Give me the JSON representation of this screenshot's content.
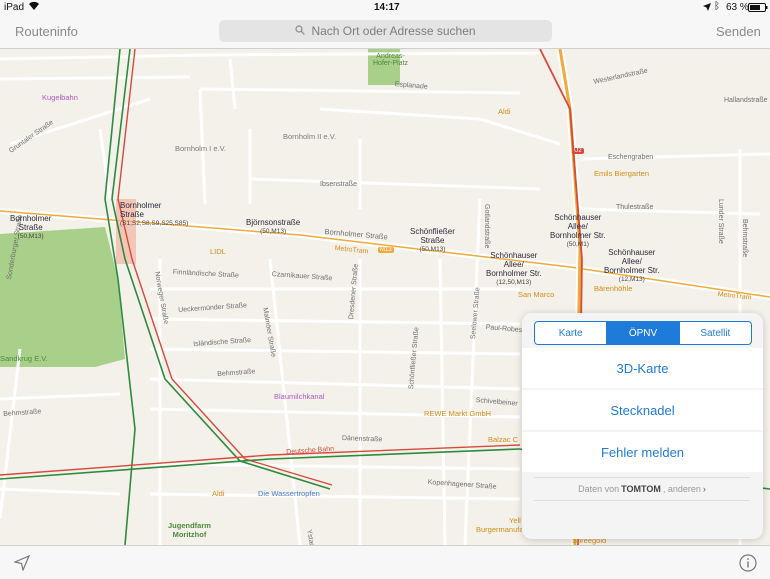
{
  "status": {
    "device": "iPad",
    "time": "14:17",
    "battery": "63 %"
  },
  "nav": {
    "left": "Routeninfo",
    "right": "Senden",
    "search_placeholder": "Nach Ort oder Adresse suchen"
  },
  "map_labels": {
    "andreas": "Andreas-\nHofer-Platz",
    "westerland": "Westerlandstraße",
    "hallandstr": "Hallandstraße",
    "esplanade": "Esplanade",
    "aldi1": "Aldi",
    "kugelbahn": "Kugelbahn",
    "grunt": "Gruntaler Straße",
    "bornholm1": "Bornholm I e.V.",
    "bornholm2": "Bornholm II e.V.",
    "eschengraben": "Eschengraben",
    "emils": "Emils Biergarten",
    "ibsen": "Ibsenstraße",
    "thulestr": "Thulestraße",
    "lunder": "Lunder Straße",
    "goth": "Gotlandstraße",
    "bornholmer_str_label": "Bornholmer Straße",
    "metrotram1": "MetroTram",
    "m13": "M13",
    "u2": "U2",
    "lidl": "LIDL",
    "finn": "Finnländische Straße",
    "czarn": "Czarnikauer Straße",
    "uecker": "Ueckermünder Straße",
    "island": "Isländische Straße",
    "behm": "Behmstraße",
    "malmoer": "Malmöer Straße",
    "dreso": "Dresdener Straße",
    "schonfl": "Schönfließer Straße",
    "seelower": "Seelower Straße",
    "paulrob": "Paul-Robeson",
    "schivel": "Schivelbeiner",
    "rewe": "REWE Markt GmbH",
    "blaumilch": "Blaumilchkanal",
    "danen": "Dänenstraße",
    "balzac": "Balzac C",
    "deutschebahn": "Deutsche Bahn",
    "kopenhag": "Kopenhagener Straße",
    "aldi2": "Aldi",
    "wasser": "Die Wassertropfen",
    "jugend": "Jugendfarm\nMoritzhof",
    "sandkrug": "Sandkrug E.V.",
    "sondenburg": "Sonderburger Straße",
    "behmstr2": "Behmstraße",
    "sanmarco": "San Marco",
    "baerenhoehle": "Bärenhöhle",
    "metrotram2": "MetroTram",
    "norweg": "Norweger Straße",
    "ystad": "Ystader Straße",
    "burger": "Burgermanufak",
    "yell": "Yell",
    "spreegold": "Spreegold"
  },
  "stops": [
    {
      "name": "Bornholmer\nStraße",
      "sub": "(50,M13)"
    },
    {
      "name": "Bornholmer\nStraße",
      "sub": "(S1,S2,S8,S9,S25,S85)"
    },
    {
      "name": "Björnsonstraße",
      "sub": "(50,M13)"
    },
    {
      "name": "Schönfließer\nStraße",
      "sub": "(50,M13)"
    },
    {
      "name": "Schönhauser\nAllee/\nBornholmer Str.",
      "sub": "(50,M1)"
    },
    {
      "name": "Schönhauser\nAllee/\nBornholmer Str.",
      "sub": "(12,50,M13)"
    },
    {
      "name": "Schönhauser\nAllee/\nBornholmer Str.",
      "sub": "(12,M13)"
    }
  ],
  "panel": {
    "segments": [
      "Karte",
      "ÖPNV",
      "Satellit"
    ],
    "selected": "ÖPNV",
    "button_3d": "3D-Karte",
    "button_pin": "Stecknadel",
    "button_report": "Fehler melden",
    "attribution_prefix": "Daten von",
    "attribution_brand": "TOMTOM",
    "attribution_suffix": ", anderen"
  },
  "colors": {
    "accent": "#1e7bd9",
    "rail_red": "#d64a3c",
    "rail_green": "#2e8b3d",
    "tram_orange": "#f0a93a"
  }
}
